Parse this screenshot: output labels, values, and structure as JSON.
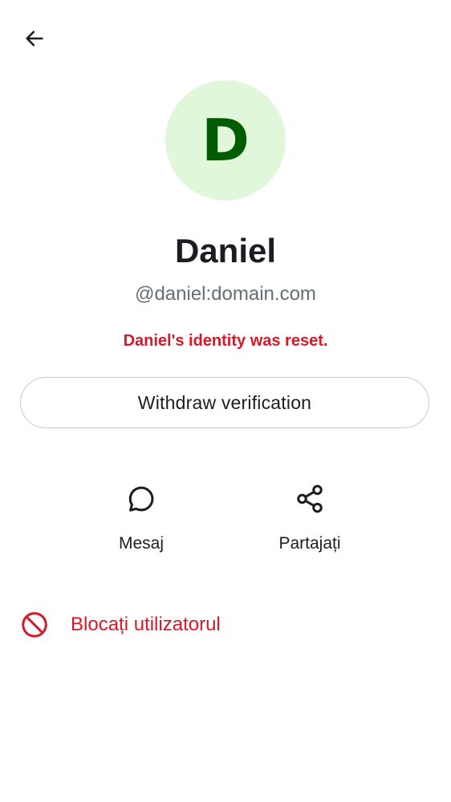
{
  "header": {
    "back_icon": "arrow-left-icon"
  },
  "profile": {
    "avatar_initial": "D",
    "avatar_bg": "#e0f8d9",
    "avatar_fg": "#005c00",
    "display_name": "Daniel",
    "user_id": "@daniel:domain.com",
    "identity_warning": "Daniel's identity was reset."
  },
  "verification": {
    "withdraw_label": "Withdraw verification"
  },
  "actions": {
    "message": {
      "label": "Mesaj",
      "icon": "chat-bubble-icon"
    },
    "share": {
      "label": "Partajați",
      "icon": "share-icon"
    }
  },
  "block": {
    "label": "Blocați utilizatorul",
    "icon": "block-icon",
    "color": "#d51928"
  }
}
